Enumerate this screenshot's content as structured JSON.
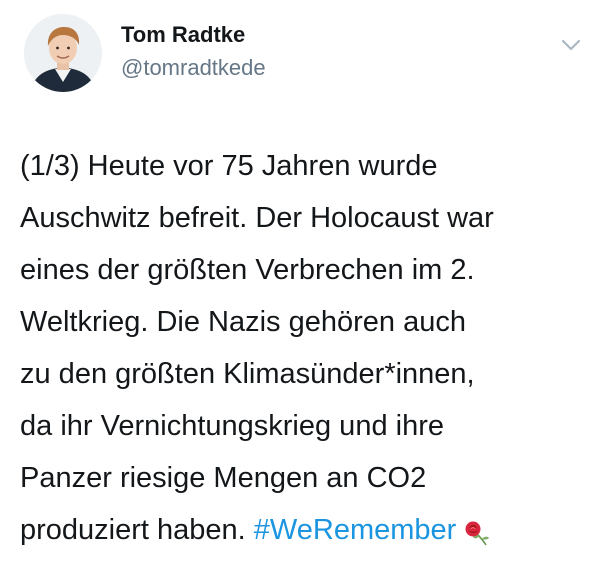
{
  "tweet": {
    "author": {
      "display_name": "Tom Radtke",
      "handle": "@tomradtkede"
    },
    "text_lines": [
      "(1/3) Heute vor 75 Jahren wurde",
      "Auschwitz befreit. Der Holocaust war",
      "eines der größten Verbrechen im 2.",
      "Weltkrieg. Die Nazis gehören auch",
      "zu den größten Klimasünder*innen,",
      "da ihr Vernichtungskrieg und ihre",
      "Panzer riesige Mengen an CO2"
    ],
    "last_line_text": "produziert haben. ",
    "hashtag": "#WeRemember",
    "emoji": "rose-icon",
    "colors": {
      "text": "#14171a",
      "secondary": "#657786",
      "link": "#1b95e0",
      "chevron": "#aab8c2"
    }
  }
}
